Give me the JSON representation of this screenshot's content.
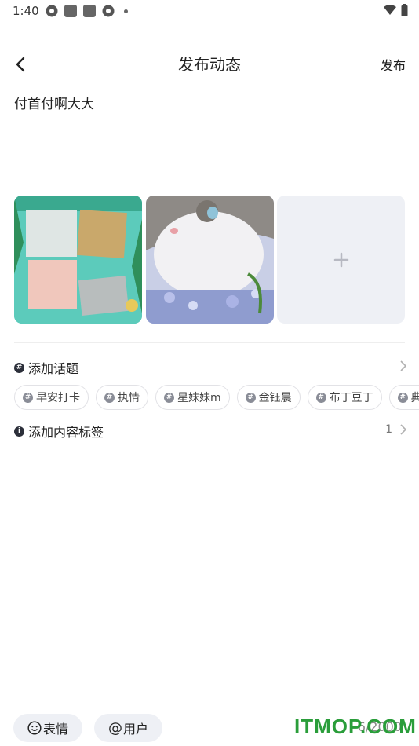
{
  "status": {
    "time": "1:40"
  },
  "header": {
    "title": "发布动态",
    "publish_label": "发布"
  },
  "post": {
    "text": "付首付啊大大"
  },
  "topics": {
    "label": "添加话题",
    "chips": [
      "早安打卡",
      "执情",
      "星妹妹m",
      "金钰晨",
      "布丁豆丁",
      "典"
    ]
  },
  "content_tags": {
    "label": "添加内容标签",
    "count": "1"
  },
  "toolbar": {
    "emoji_label": "表情",
    "user_label": "用户",
    "counter": "6/2000"
  },
  "watermark": "ITMOP.COM",
  "colors": {
    "accent_bg": "#eef0f5",
    "text": "#222222",
    "watermark": "#2a9d3a"
  }
}
